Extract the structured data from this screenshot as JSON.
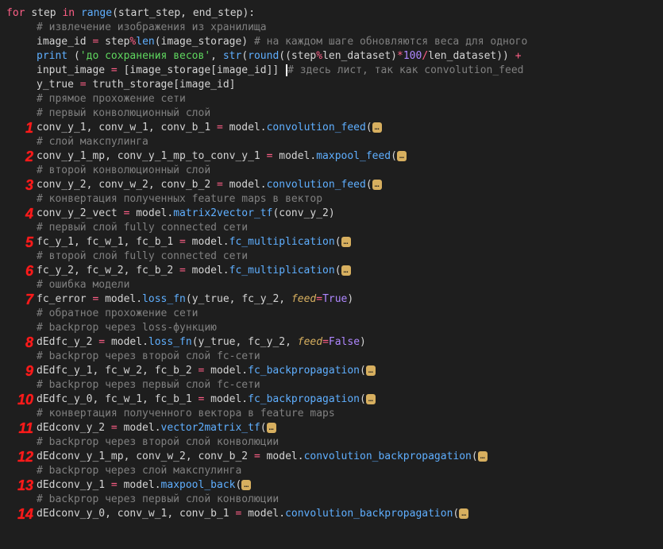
{
  "annotations": [
    "1",
    "2",
    "3",
    "4",
    "5",
    "6",
    "7",
    "8",
    "9",
    "10",
    "11",
    "12",
    "13",
    "14"
  ],
  "code": {
    "l1": {
      "for": "for",
      "step": "step",
      "in": "in",
      "range": "range",
      "args": "(start_step, end_step):"
    },
    "l2": {
      "comment": "# извлечение изображения из хранилища"
    },
    "l3": {
      "a": "image_id ",
      "eq": "= ",
      "b": "step",
      "mod": "%",
      "len": "len",
      "c": "(image_storage) ",
      "com": "# на каждом шаге обновляются веса для одного"
    },
    "l4": {
      "print": "print",
      "sp": " (",
      "s1": "'до сохранения весов'",
      "c1": ", ",
      "str_f": "str",
      "p1": "(",
      "round": "round",
      "p2": "((step",
      "mod": "%",
      "ld": "len_dataset)",
      "mul": "*",
      "n100": "100",
      "div": "/",
      "ld2": "len_dataset)) ",
      "plus": "+"
    },
    "l5": {
      "a": "input_image ",
      "eq": "= ",
      "b": "[image_storage[image_id]] ",
      "com": "# здесь лист, так как convolution_feed"
    },
    "l6": {
      "a": "y_true ",
      "eq": "= ",
      "b": "truth_storage[image_id]"
    },
    "l7": {
      "com": "# прямое прохожение сети"
    },
    "l8": {
      "com": "# первый конволюционный слой"
    },
    "l9": {
      "a": "conv_y_1, conv_w_1, conv_b_1 ",
      "eq": "= ",
      "m": "model.",
      "f": "convolution_feed",
      "p": "("
    },
    "l10": {
      "com": "# слой макспулинга"
    },
    "l11": {
      "a": "conv_y_1_mp, conv_y_1_mp_to_conv_y_1 ",
      "eq": "= ",
      "m": "model.",
      "f": "maxpool_feed",
      "p": "("
    },
    "l12": {
      "com": "# второй конволюционный слой"
    },
    "l13": {
      "a": "conv_y_2, conv_w_2, conv_b_2 ",
      "eq": "= ",
      "m": "model.",
      "f": "convolution_feed",
      "p": "("
    },
    "l14": {
      "com": "# конвертация полученных feature maps в вектор"
    },
    "l15": {
      "a": "conv_y_2_vect ",
      "eq": "= ",
      "m": "model.",
      "f": "matrix2vector_tf",
      "p": "(conv_y_2)"
    },
    "l16": {
      "com": "# первый слой fully connected сети"
    },
    "l17": {
      "a": "fc_y_1, fc_w_1, fc_b_1 ",
      "eq": "= ",
      "m": "model.",
      "f": "fc_multiplication",
      "p": "("
    },
    "l18": {
      "com": "# второй слой fully connected сети"
    },
    "l19": {
      "a": "fc_y_2, fc_w_2, fc_b_2 ",
      "eq": "= ",
      "m": "model.",
      "f": "fc_multiplication",
      "p": "("
    },
    "l20": {
      "com": "# ошибка модели"
    },
    "l21": {
      "a": "fc_error ",
      "eq": "= ",
      "m": "model.",
      "f": "loss_fn",
      "p": "(y_true, fc_y_2, ",
      "kw": "feed",
      "eq2": "=",
      "v": "True",
      "p2": ")"
    },
    "l22": {
      "com": "# обратное прохожение сети"
    },
    "l23": {
      "com": "# backprop через loss-функцию"
    },
    "l24": {
      "a": "dEdfc_y_2 ",
      "eq": "= ",
      "m": "model.",
      "f": "loss_fn",
      "p": "(y_true, fc_y_2, ",
      "kw": "feed",
      "eq2": "=",
      "v": "False",
      "p2": ")"
    },
    "l25": {
      "com": "# backprop через второй слой fc-сети"
    },
    "l26": {
      "a": "dEdfc_y_1, fc_w_2, fc_b_2 ",
      "eq": "= ",
      "m": "model.",
      "f": "fc_backpropagation",
      "p": "("
    },
    "l27": {
      "com": "# backprop через первый слой fc-сети"
    },
    "l28": {
      "a": "dEdfc_y_0, fc_w_1, fc_b_1 ",
      "eq": "= ",
      "m": "model.",
      "f": "fc_backpropagation",
      "p": "("
    },
    "l29": {
      "com": "# конвертация полученного вектора в feature maps"
    },
    "l30": {
      "a": "dEdconv_y_2 ",
      "eq": "= ",
      "m": "model.",
      "f": "vector2matrix_tf",
      "p": "("
    },
    "l31": {
      "com": "# backprop через второй слой конволюции"
    },
    "l32": {
      "a": "dEdconv_y_1_mp, conv_w_2, conv_b_2 ",
      "eq": "= ",
      "m": "model.",
      "f": "convolution_backpropagation",
      "p": "("
    },
    "l33": {
      "com": "# backprop через слой макспулинга"
    },
    "l34": {
      "a": "dEdconv_y_1 ",
      "eq": "= ",
      "m": "model.",
      "f": "maxpool_back",
      "p": "("
    },
    "l35": {
      "com": "# backprop через первый слой конволюции"
    },
    "l36": {
      "a": "dEdconv_y_0, conv_w_1, conv_b_1 ",
      "eq": "= ",
      "m": "model.",
      "f": "convolution_backpropagation",
      "p": "("
    },
    "fold": "…"
  }
}
